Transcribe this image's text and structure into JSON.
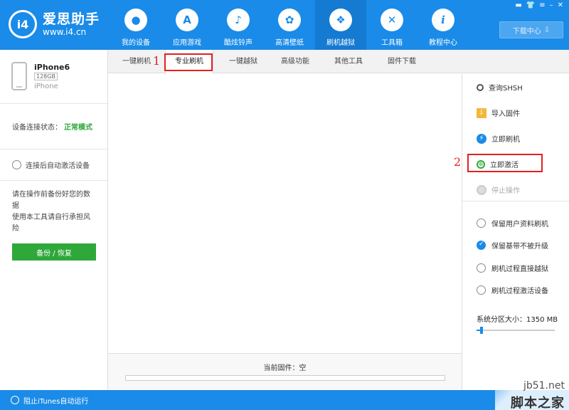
{
  "app": {
    "name": "爱思助手",
    "url": "www.i4.cn",
    "logo_mark": "i4"
  },
  "nav": [
    {
      "label": "我的设备",
      "icon": "apple-icon",
      "glyph": ""
    },
    {
      "label": "应用游戏",
      "icon": "app-store-icon",
      "glyph": "A"
    },
    {
      "label": "酷炫铃声",
      "icon": "bell-icon",
      "glyph": "♪"
    },
    {
      "label": "高清壁纸",
      "icon": "flower-icon",
      "glyph": "✿"
    },
    {
      "label": "刷机越狱",
      "icon": "dropbox-icon",
      "glyph": "❖"
    },
    {
      "label": "工具箱",
      "icon": "tools-icon",
      "glyph": "✕"
    },
    {
      "label": "教程中心",
      "icon": "info-icon",
      "glyph": "i"
    }
  ],
  "window_controls": [
    "▬",
    "👕",
    "≡",
    "–",
    "✕"
  ],
  "download_center": {
    "label": "下载中心",
    "glyph": "⇩"
  },
  "device": {
    "name": "iPhone6",
    "capacity": "128GB",
    "type": "iPhone"
  },
  "status": {
    "label": "设备连接状态：",
    "value": "正常模式"
  },
  "auto_activate": "连接后自动激活设备",
  "warning": {
    "line1": "请在操作前备份好您的数据",
    "line2": "使用本工具请自行承担风险"
  },
  "backup_button": "备份 / 恢复",
  "subtabs": [
    "一键刷机",
    "专业刷机",
    "一键越狱",
    "高级功能",
    "其他工具",
    "固件下载"
  ],
  "annotations": {
    "one": "1",
    "two": "2"
  },
  "actions": [
    {
      "label": "查询SHSH",
      "glyph": ""
    },
    {
      "label": "导入固件",
      "glyph": "⇩"
    },
    {
      "label": "立即刷机",
      "glyph": "⚡"
    },
    {
      "label": "立即激活",
      "glyph": "⊕"
    },
    {
      "label": "停止操作",
      "glyph": ""
    }
  ],
  "options": [
    {
      "label": "保留用户资料刷机",
      "checked": false
    },
    {
      "label": "保留基带不被升级",
      "checked": true
    },
    {
      "label": "刷机过程直接越狱",
      "checked": false
    },
    {
      "label": "刷机过程激活设备",
      "checked": false
    }
  ],
  "partition": {
    "label": "系统分区大小：1350 MB",
    "fraction": 0.06
  },
  "firmware": {
    "label": "当前固件：空"
  },
  "itunes": "阻止iTunes自动运行",
  "watermark": {
    "url": "jb51.net",
    "name": "脚本之家"
  }
}
